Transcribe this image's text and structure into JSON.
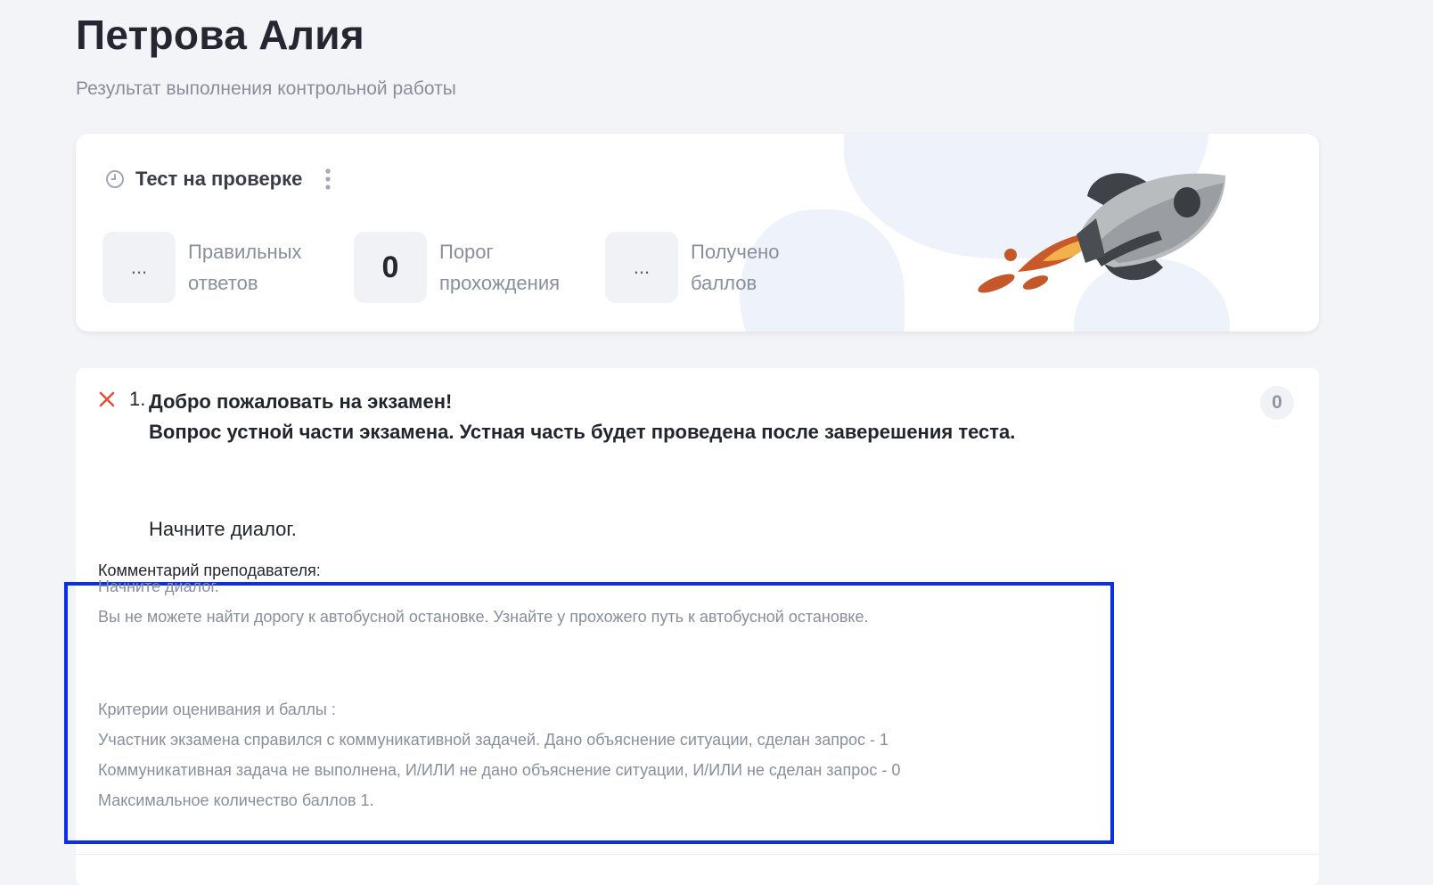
{
  "header": {
    "title": "Петрова Алия",
    "subtitle": "Результат выполнения контрольной работы"
  },
  "summary": {
    "status": "Тест на проверке",
    "status_icon": "clock-icon",
    "more_icon": "more-vertical-icon",
    "stats": [
      {
        "value": "...",
        "label_line1": "Правильных",
        "label_line2": "ответов"
      },
      {
        "value": "0",
        "label_line1": "Порог",
        "label_line2": "прохождения"
      },
      {
        "value": "...",
        "label_line1": "Получено",
        "label_line2": "баллов"
      }
    ],
    "illustration": "rocket-illustration"
  },
  "question": {
    "number": "1.",
    "title_line1": "Добро пожаловать на экзамен!",
    "title_line2": "Вопрос устной части экзамена. Устная часть будет проведена после заверешения теста.",
    "instruction": "Начните диалог.",
    "score": "0",
    "status_icon": "cross-icon",
    "comment_label": "Комментарий преподавателя:",
    "comment_lines": [
      "Начните диалог.",
      "Вы не можете найти дорогу к автобусной остановке. Узнайте у прохожего путь к автобусной остановке.",
      "Критерии оценивания и баллы :",
      "Участник экзамена справился с коммуникативной задачей. Дано объяснение ситуации, сделан запрос - 1",
      "Коммуникативная задача не выполнена, И/ИЛИ не дано объяснение ситуации, И/ИЛИ не сделан запрос - 0",
      "Максимальное количество баллов 1."
    ]
  },
  "colors": {
    "background": "#f3f4f7",
    "highlight_border": "#0a2fe8",
    "wrong_icon": "#e0533b",
    "muted_text": "#8a8e9c"
  }
}
